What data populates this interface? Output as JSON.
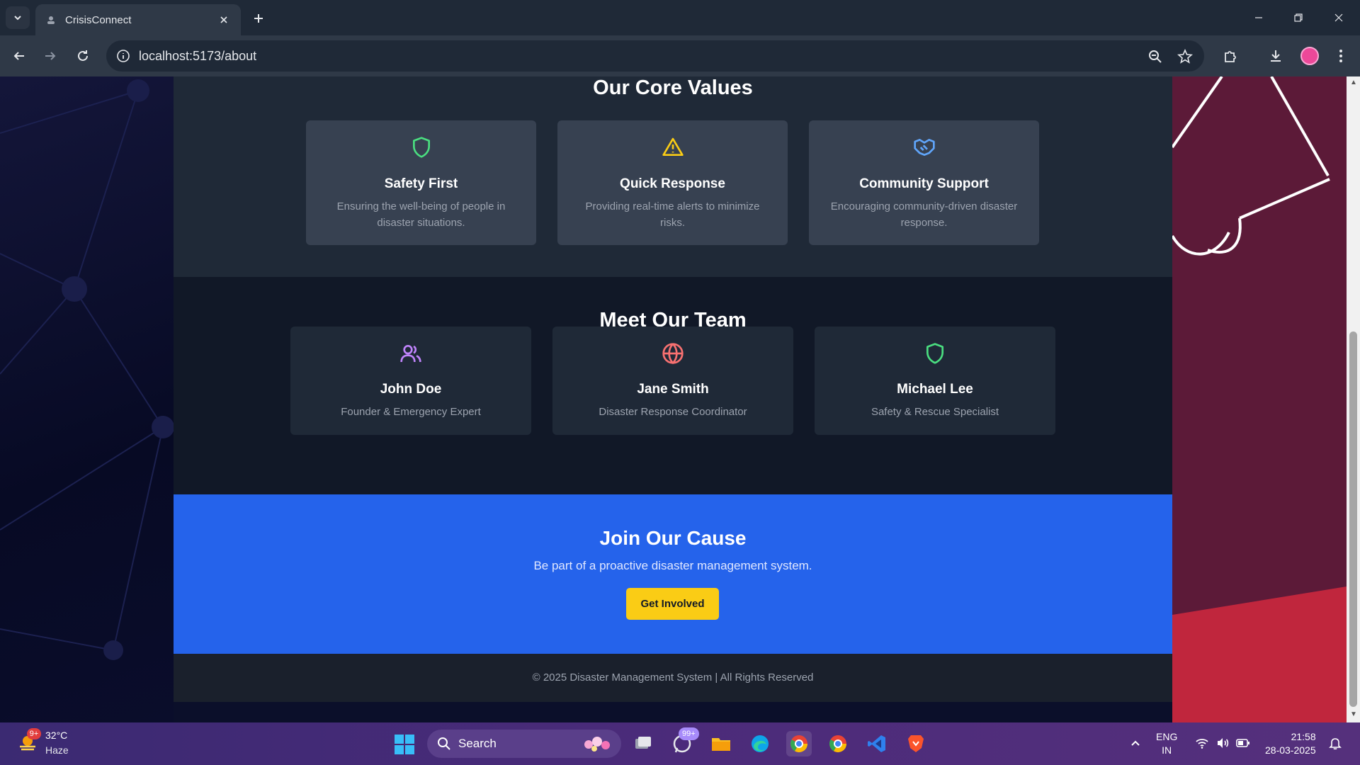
{
  "browser": {
    "tab_title": "CrisisConnect",
    "url": "localhost:5173/about"
  },
  "values": {
    "title": "Our Core Values",
    "cards": [
      {
        "icon": "shield-icon",
        "color": "#4ade80",
        "title": "Safety First",
        "desc": "Ensuring the well-being of people in disaster situations."
      },
      {
        "icon": "warning-icon",
        "color": "#facc15",
        "title": "Quick Response",
        "desc": "Providing real-time alerts to minimize risks."
      },
      {
        "icon": "handshake-icon",
        "color": "#60a5fa",
        "title": "Community Support",
        "desc": "Encouraging community-driven disaster response."
      }
    ]
  },
  "team": {
    "title": "Meet Our Team",
    "members": [
      {
        "icon": "users-icon",
        "color": "#c084fc",
        "name": "John Doe",
        "role": "Founder & Emergency Expert"
      },
      {
        "icon": "globe-icon",
        "color": "#f87171",
        "name": "Jane Smith",
        "role": "Disaster Response Coordinator"
      },
      {
        "icon": "shield-icon",
        "color": "#4ade80",
        "name": "Michael Lee",
        "role": "Safety & Rescue Specialist"
      }
    ]
  },
  "cta": {
    "title": "Join Our Cause",
    "subtitle": "Be part of a proactive disaster management system.",
    "button": "Get Involved"
  },
  "footer": {
    "text": "© 2025 Disaster Management System | All Rights Reserved"
  },
  "taskbar": {
    "weather_badge": "9+",
    "temperature": "32°C",
    "condition": "Haze",
    "search_label": "Search",
    "whatsapp_badge": "99+",
    "lang_line1": "ENG",
    "lang_line2": "IN",
    "time": "21:58",
    "date": "28-03-2025"
  },
  "colors": {
    "accent_blue": "#2563eb",
    "button_yellow": "#facc15",
    "dark_bg": "#111827",
    "card_bg": "#374151"
  }
}
